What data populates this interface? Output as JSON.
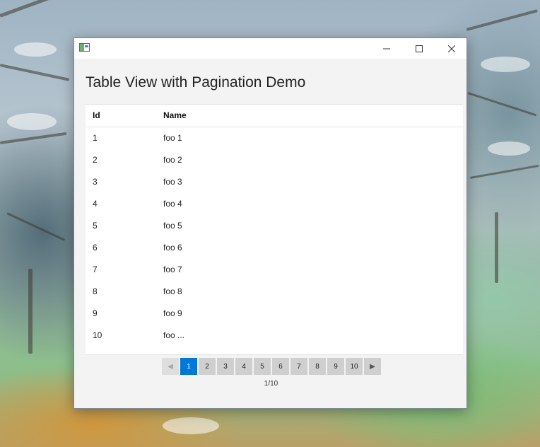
{
  "window": {
    "title": "",
    "minimize_icon": "minimize-icon",
    "maximize_icon": "maximize-icon",
    "close_icon": "close-icon"
  },
  "page": {
    "title": "Table View with Pagination Demo"
  },
  "table": {
    "columns": [
      "Id",
      "Name"
    ],
    "rows": [
      {
        "id": "1",
        "name": "foo 1"
      },
      {
        "id": "2",
        "name": "foo 2"
      },
      {
        "id": "3",
        "name": "foo 3"
      },
      {
        "id": "4",
        "name": "foo 4"
      },
      {
        "id": "5",
        "name": "foo 5"
      },
      {
        "id": "6",
        "name": "foo 6"
      },
      {
        "id": "7",
        "name": "foo 7"
      },
      {
        "id": "8",
        "name": "foo 8"
      },
      {
        "id": "9",
        "name": "foo 9"
      },
      {
        "id": "10",
        "name": "foo ..."
      }
    ]
  },
  "pagination": {
    "prev_icon": "◀",
    "next_icon": "▶",
    "pages": [
      "1",
      "2",
      "3",
      "4",
      "5",
      "6",
      "7",
      "8",
      "9",
      "10"
    ],
    "current_page": "1",
    "status": "1/10"
  },
  "colors": {
    "accent": "#0078d7",
    "page_button": "#cfcfcf",
    "window_bg": "#f3f3f3"
  }
}
